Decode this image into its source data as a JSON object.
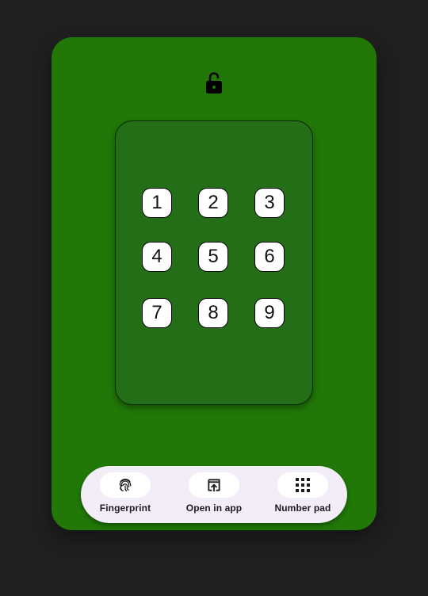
{
  "lock": {
    "icon": "lock-open-icon",
    "color": "#000000"
  },
  "keypad": {
    "keys": [
      "1",
      "2",
      "3",
      "4",
      "5",
      "6",
      "7",
      "8",
      "9"
    ]
  },
  "bottom_bar": {
    "items": [
      {
        "label": "Fingerprint",
        "icon": "fingerprint-icon"
      },
      {
        "label": "Open in app",
        "icon": "open-in-app-icon"
      },
      {
        "label": "Number pad",
        "icon": "number-pad-icon"
      }
    ]
  },
  "colors": {
    "device_background": "#217807",
    "keypad_background": "#246e17",
    "bar_background": "#f3edf7",
    "page_background": "#202020"
  }
}
